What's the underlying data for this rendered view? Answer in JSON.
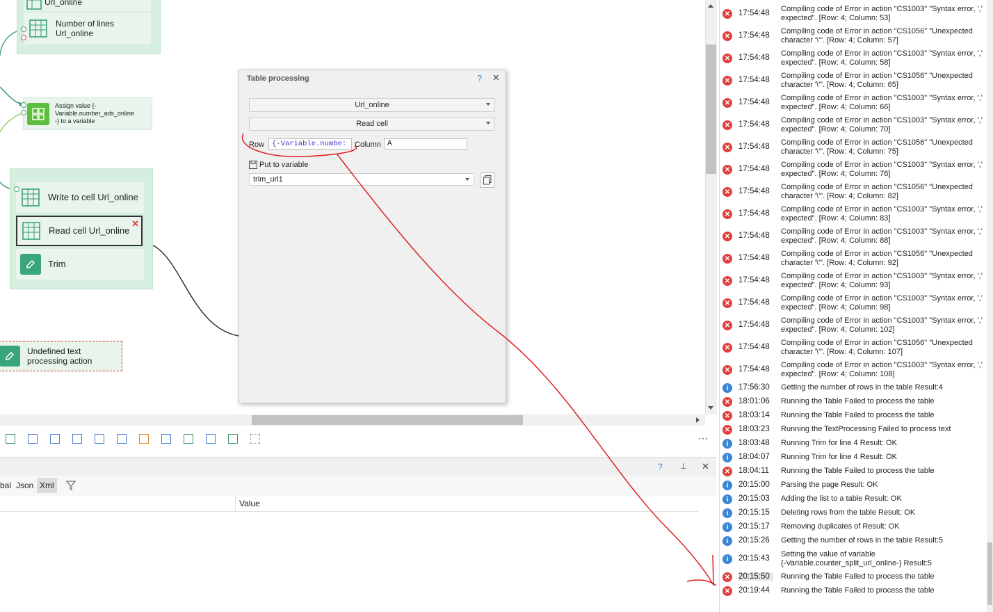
{
  "canvas": {
    "top_group_items": [
      {
        "label": "Url_online"
      },
      {
        "label": "Number of lines\nUrl_online"
      }
    ],
    "assign_node": {
      "label": "Assign value {-\nVariable.number_ads_online\n-} to a variable"
    },
    "table_group_items": [
      {
        "label": "Write to cell Url_online"
      },
      {
        "label": "Read cell Url_online"
      },
      {
        "label": "Trim"
      }
    ],
    "undefined_node": {
      "label": "Undefined text\nprocessing action"
    }
  },
  "dialog": {
    "title": "Table processing",
    "help": "?",
    "close": "✕",
    "table_select": "Url_online",
    "action_select": "Read cell",
    "row_label": "Row",
    "row_value": "{-Variable.numbe:",
    "column_label": "Column",
    "column_value": "A",
    "put_label": "Put to variable",
    "variable_select": "trim_url1"
  },
  "bottom_panel": {
    "tabs": [
      "bal",
      "Json",
      "Xml"
    ],
    "active_tab": "Xml",
    "column_value": "Value",
    "help": "?",
    "close": "✕",
    "more": "⋯"
  },
  "log": [
    {
      "type": "error",
      "time": "17:54:48",
      "msg": "Compiling code of Error in action \"CS1003\" \"Syntax error, ',' expected\". [Row: 4; Column: 53]"
    },
    {
      "type": "error",
      "time": "17:54:48",
      "msg": "Compiling code of Error in action \"CS1056\" \"Unexpected character '\\'\". [Row: 4; Column: 57]"
    },
    {
      "type": "error",
      "time": "17:54:48",
      "msg": "Compiling code of Error in action \"CS1003\" \"Syntax error, ',' expected\". [Row: 4; Column: 58]"
    },
    {
      "type": "error",
      "time": "17:54:48",
      "msg": "Compiling code of Error in action \"CS1056\" \"Unexpected character '\\'\". [Row: 4; Column: 65]"
    },
    {
      "type": "error",
      "time": "17:54:48",
      "msg": "Compiling code of Error in action \"CS1003\" \"Syntax error, ',' expected\". [Row: 4; Column: 66]"
    },
    {
      "type": "error",
      "time": "17:54:48",
      "msg": "Compiling code of Error in action \"CS1003\" \"Syntax error, ',' expected\". [Row: 4; Column: 70]"
    },
    {
      "type": "error",
      "time": "17:54:48",
      "msg": "Compiling code of Error in action \"CS1056\" \"Unexpected character '\\'\". [Row: 4; Column: 75]"
    },
    {
      "type": "error",
      "time": "17:54:48",
      "msg": "Compiling code of Error in action \"CS1003\" \"Syntax error, ',' expected\". [Row: 4; Column: 76]"
    },
    {
      "type": "error",
      "time": "17:54:48",
      "msg": "Compiling code of Error in action \"CS1056\" \"Unexpected character '\\'\". [Row: 4; Column: 82]"
    },
    {
      "type": "error",
      "time": "17:54:48",
      "msg": "Compiling code of Error in action \"CS1003\" \"Syntax error, ',' expected\". [Row: 4; Column: 83]"
    },
    {
      "type": "error",
      "time": "17:54:48",
      "msg": "Compiling code of Error in action \"CS1003\" \"Syntax error, ',' expected\". [Row: 4; Column: 88]"
    },
    {
      "type": "error",
      "time": "17:54:48",
      "msg": "Compiling code of Error in action \"CS1056\" \"Unexpected character '\\'\". [Row: 4; Column: 92]"
    },
    {
      "type": "error",
      "time": "17:54:48",
      "msg": "Compiling code of Error in action \"CS1003\" \"Syntax error, ',' expected\". [Row: 4; Column: 93]"
    },
    {
      "type": "error",
      "time": "17:54:48",
      "msg": "Compiling code of Error in action \"CS1003\" \"Syntax error, ',' expected\". [Row: 4; Column: 98]"
    },
    {
      "type": "error",
      "time": "17:54:48",
      "msg": "Compiling code of Error in action \"CS1003\" \"Syntax error, ',' expected\". [Row: 4; Column: 102]"
    },
    {
      "type": "error",
      "time": "17:54:48",
      "msg": "Compiling code of Error in action \"CS1056\" \"Unexpected character '\\'\". [Row: 4; Column: 107]"
    },
    {
      "type": "error",
      "time": "17:54:48",
      "msg": "Compiling code of Error in action \"CS1003\" \"Syntax error, ',' expected\". [Row: 4; Column: 108]"
    },
    {
      "type": "info",
      "time": "17:56:30",
      "msg": "Getting the number of rows in the table  Result:4"
    },
    {
      "type": "error",
      "time": "18:01:06",
      "msg": "Running the Table  Failed to process the table"
    },
    {
      "type": "error",
      "time": "18:03:14",
      "msg": "Running the Table  Failed to process the table"
    },
    {
      "type": "error",
      "time": "18:03:23",
      "msg": "Running the TextProcessing  Failed to process text"
    },
    {
      "type": "info",
      "time": "18:03:48",
      "msg": "Running Trim for line 4  Result: OK"
    },
    {
      "type": "info",
      "time": "18:04:07",
      "msg": "Running Trim for line 4  Result: OK"
    },
    {
      "type": "error",
      "time": "18:04:11",
      "msg": "Running the Table  Failed to process the table"
    },
    {
      "type": "info",
      "time": "20:15:00",
      "msg": "Parsing the page  Result: OK"
    },
    {
      "type": "info",
      "time": "20:15:03",
      "msg": "Adding the list to a table  Result: OK"
    },
    {
      "type": "info",
      "time": "20:15:15",
      "msg": "Deleting rows from the table  Result: OK"
    },
    {
      "type": "info",
      "time": "20:15:17",
      "msg": "Removing duplicates of  Result: OK"
    },
    {
      "type": "info",
      "time": "20:15:26",
      "msg": "Getting the number of rows in the table  Result:5"
    },
    {
      "type": "info",
      "time": "20:15:43",
      "msg": "Setting the value of variable\n{-Variable.counter_split_url_online-}  Result:5"
    },
    {
      "type": "error",
      "time": "20:15:50",
      "msg": "Running the Table  Failed to process the table"
    },
    {
      "type": "error",
      "time": "20:19:44",
      "msg": "Running the Table  Failed to process the table"
    }
  ]
}
